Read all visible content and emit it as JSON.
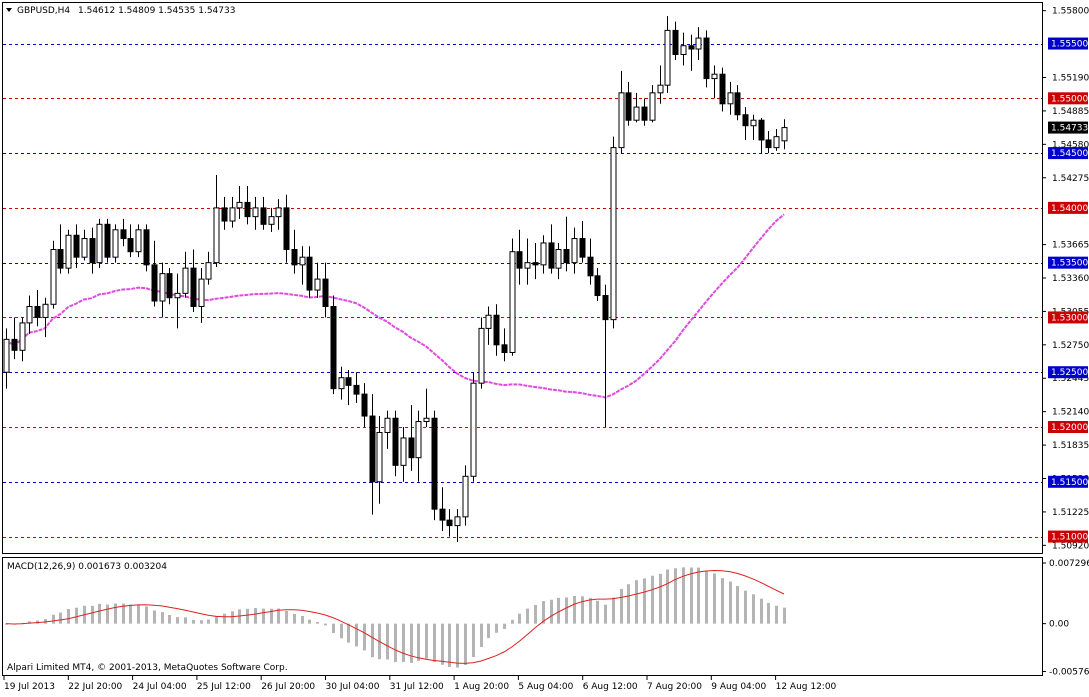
{
  "header": {
    "symbol": "GBPUSD,H4",
    "ohlc": "1.54612 1.54809 1.54535 1.54733"
  },
  "macd_header": {
    "label": "MACD(12,26,9) 0.001673 0.003204"
  },
  "footer": {
    "copyright": "Alpari Limited MT4, © 2001-2013, MetaQuotes Software Corp."
  },
  "colors": {
    "candle": "#000000",
    "bollinger": "#1e90ff",
    "ma_green": "#2ee08a",
    "ma_magenta": "#e04ae0",
    "level_blue": "#0000cc",
    "level_red": "#cc0000",
    "macd_hist": "#b4b4b4",
    "macd_signal": "#dd2222",
    "current_price_bg": "#000000"
  },
  "chart_data": [
    {
      "type": "candlestick",
      "name": "GBPUSD H4",
      "ylim": [
        1.5085,
        1.5587
      ],
      "y_ticks": [
        "1.55800",
        "1.55500",
        "1.55190",
        "1.54885",
        "1.54733",
        "1.54580",
        "1.54500",
        "1.54275",
        "1.54000",
        "1.53665",
        "1.53500",
        "1.53360",
        "1.53055",
        "1.53000",
        "1.52750",
        "1.52500",
        "1.52445",
        "1.52140",
        "1.52000",
        "1.51835",
        "1.51500",
        "1.51530",
        "1.51225",
        "1.51000",
        "1.50920"
      ],
      "price_labels": [
        {
          "text": "1.55800",
          "value": 1.558
        },
        {
          "text": "1.55190",
          "value": 1.5519
        },
        {
          "text": "1.54885",
          "value": 1.54885
        },
        {
          "text": "1.54580",
          "value": 1.5458
        },
        {
          "text": "1.54275",
          "value": 1.54275
        },
        {
          "text": "1.53665",
          "value": 1.53665
        },
        {
          "text": "1.53360",
          "value": 1.5336
        },
        {
          "text": "1.53055",
          "value": 1.53055
        },
        {
          "text": "1.52750",
          "value": 1.5275
        },
        {
          "text": "1.52445",
          "value": 1.52445
        },
        {
          "text": "1.52140",
          "value": 1.5214
        },
        {
          "text": "1.51835",
          "value": 1.51835
        },
        {
          "text": "1.51530",
          "value": 1.5153
        },
        {
          "text": "1.51225",
          "value": 1.51225
        },
        {
          "text": "1.50920",
          "value": 1.5092
        }
      ],
      "levels": [
        {
          "text": "1.55500",
          "value": 1.555,
          "color": "blue"
        },
        {
          "text": "1.55000",
          "value": 1.55,
          "color": "red"
        },
        {
          "text": "1.54500",
          "value": 1.545,
          "color": "blue"
        },
        {
          "text": "1.54000",
          "value": 1.54,
          "color": "red"
        },
        {
          "text": "1.53500",
          "value": 1.535,
          "color": "blue"
        },
        {
          "text": "1.53000",
          "value": 1.53,
          "color": "red"
        },
        {
          "text": "1.52500",
          "value": 1.525,
          "color": "blue"
        },
        {
          "text": "1.52000",
          "value": 1.52,
          "color": "red"
        },
        {
          "text": "1.51500",
          "value": 1.515,
          "color": "blue"
        },
        {
          "text": "1.51000",
          "value": 1.51,
          "color": "red"
        }
      ],
      "current_price": {
        "text": "1.54733",
        "value": 1.54733
      },
      "x_labels": [
        "19 Jul 2013",
        "22 Jul 20:00",
        "24 Jul 04:00",
        "25 Jul 12:00",
        "26 Jul 20:00",
        "30 Jul 04:00",
        "31 Jul 12:00",
        "1 Aug 20:00",
        "5 Aug 04:00",
        "6 Aug 12:00",
        "7 Aug 20:00",
        "9 Aug 04:00",
        "12 Aug 12:00"
      ],
      "ohlc": [
        [
          1.525,
          1.529,
          1.5235,
          1.528
        ],
        [
          1.528,
          1.53,
          1.5262,
          1.527
        ],
        [
          1.527,
          1.53,
          1.526,
          1.5295
        ],
        [
          1.5295,
          1.532,
          1.5285,
          1.531
        ],
        [
          1.531,
          1.5325,
          1.5292,
          1.53
        ],
        [
          1.53,
          1.5318,
          1.5282,
          1.5312
        ],
        [
          1.5312,
          1.537,
          1.5308,
          1.5362
        ],
        [
          1.5362,
          1.5385,
          1.534,
          1.5345
        ],
        [
          1.5345,
          1.538,
          1.534,
          1.5375
        ],
        [
          1.5375,
          1.5385,
          1.5345,
          1.5355
        ],
        [
          1.5355,
          1.538,
          1.5352,
          1.5372
        ],
        [
          1.5372,
          1.5382,
          1.534,
          1.535
        ],
        [
          1.535,
          1.539,
          1.5345,
          1.5385
        ],
        [
          1.5385,
          1.539,
          1.535,
          1.5355
        ],
        [
          1.5355,
          1.5385,
          1.535,
          1.538
        ],
        [
          1.538,
          1.539,
          1.5365,
          1.5372
        ],
        [
          1.5372,
          1.5385,
          1.5355,
          1.536
        ],
        [
          1.536,
          1.5385,
          1.5355,
          1.538
        ],
        [
          1.538,
          1.5385,
          1.5342,
          1.5348
        ],
        [
          1.5348,
          1.537,
          1.531,
          1.5315
        ],
        [
          1.5315,
          1.535,
          1.53,
          1.534
        ],
        [
          1.534,
          1.5345,
          1.5312,
          1.5318
        ],
        [
          1.5318,
          1.534,
          1.529,
          1.5322
        ],
        [
          1.5322,
          1.536,
          1.5318,
          1.5345
        ],
        [
          1.5345,
          1.5362,
          1.5305,
          1.531
        ],
        [
          1.531,
          1.5345,
          1.5295,
          1.5335
        ],
        [
          1.5335,
          1.536,
          1.533,
          1.535
        ],
        [
          1.535,
          1.543,
          1.5346,
          1.54
        ],
        [
          1.54,
          1.541,
          1.538,
          1.5388
        ],
        [
          1.5388,
          1.541,
          1.5382,
          1.54
        ],
        [
          1.54,
          1.542,
          1.539,
          1.5405
        ],
        [
          1.5405,
          1.542,
          1.5385,
          1.5392
        ],
        [
          1.5392,
          1.541,
          1.538,
          1.54
        ],
        [
          1.54,
          1.541,
          1.538,
          1.5385
        ],
        [
          1.5385,
          1.54,
          1.5378,
          1.5392
        ],
        [
          1.5392,
          1.5408,
          1.538,
          1.54
        ],
        [
          1.54,
          1.5412,
          1.535,
          1.5362
        ],
        [
          1.5362,
          1.538,
          1.534,
          1.5348
        ],
        [
          1.5348,
          1.5365,
          1.533,
          1.5355
        ],
        [
          1.5355,
          1.5365,
          1.5318,
          1.5325
        ],
        [
          1.5325,
          1.535,
          1.5318,
          1.5335
        ],
        [
          1.5335,
          1.535,
          1.53,
          1.531
        ],
        [
          1.531,
          1.532,
          1.523,
          1.5235
        ],
        [
          1.5235,
          1.5255,
          1.5225,
          1.5245
        ],
        [
          1.5245,
          1.5252,
          1.522,
          1.5238
        ],
        [
          1.5238,
          1.525,
          1.5222,
          1.523
        ],
        [
          1.523,
          1.524,
          1.52,
          1.521
        ],
        [
          1.521,
          1.523,
          1.512,
          1.515
        ],
        [
          1.515,
          1.521,
          1.513,
          1.5195
        ],
        [
          1.5195,
          1.5215,
          1.518,
          1.5208
        ],
        [
          1.5208,
          1.5215,
          1.5155,
          1.5165
        ],
        [
          1.5165,
          1.52,
          1.515,
          1.519
        ],
        [
          1.519,
          1.522,
          1.516,
          1.5172
        ],
        [
          1.5172,
          1.5215,
          1.515,
          1.5205
        ],
        [
          1.5205,
          1.5235,
          1.52,
          1.5208
        ],
        [
          1.5208,
          1.5215,
          1.5115,
          1.5125
        ],
        [
          1.5125,
          1.5145,
          1.5105,
          1.5115
        ],
        [
          1.5115,
          1.5125,
          1.51,
          1.511
        ],
        [
          1.511,
          1.5125,
          1.5095,
          1.5118
        ],
        [
          1.5118,
          1.5165,
          1.511,
          1.5155
        ],
        [
          1.5155,
          1.525,
          1.515,
          1.524
        ],
        [
          1.524,
          1.53,
          1.5235,
          1.529
        ],
        [
          1.529,
          1.531,
          1.5275,
          1.5302
        ],
        [
          1.5302,
          1.5312,
          1.5265,
          1.5275
        ],
        [
          1.5275,
          1.529,
          1.526,
          1.5268
        ],
        [
          1.5268,
          1.5372,
          1.5265,
          1.536
        ],
        [
          1.536,
          1.538,
          1.533,
          1.5345
        ],
        [
          1.5345,
          1.5372,
          1.533,
          1.535
        ],
        [
          1.535,
          1.5368,
          1.5335,
          1.5348
        ],
        [
          1.5348,
          1.5375,
          1.534,
          1.5368
        ],
        [
          1.5368,
          1.5385,
          1.534,
          1.5345
        ],
        [
          1.5345,
          1.5368,
          1.5335,
          1.5362
        ],
        [
          1.5362,
          1.5392,
          1.5342,
          1.535
        ],
        [
          1.535,
          1.5382,
          1.534,
          1.5372
        ],
        [
          1.5372,
          1.5388,
          1.535,
          1.5355
        ],
        [
          1.5355,
          1.5372,
          1.533,
          1.5338
        ],
        [
          1.5338,
          1.5345,
          1.5315,
          1.532
        ],
        [
          1.532,
          1.533,
          1.52,
          1.5298
        ],
        [
          1.5298,
          1.5465,
          1.529,
          1.5455
        ],
        [
          1.5455,
          1.5525,
          1.545,
          1.5505
        ],
        [
          1.5505,
          1.5515,
          1.5475,
          1.548
        ],
        [
          1.548,
          1.5505,
          1.5478,
          1.5492
        ],
        [
          1.5492,
          1.55,
          1.5475,
          1.548
        ],
        [
          1.548,
          1.5512,
          1.5478,
          1.5505
        ],
        [
          1.5505,
          1.553,
          1.5495,
          1.5512
        ],
        [
          1.5512,
          1.5575,
          1.5505,
          1.5562
        ],
        [
          1.5562,
          1.557,
          1.5535,
          1.554
        ],
        [
          1.554,
          1.556,
          1.553,
          1.5548
        ],
        [
          1.5548,
          1.5558,
          1.5525,
          1.5545
        ],
        [
          1.5545,
          1.5565,
          1.5535,
          1.5555
        ],
        [
          1.5555,
          1.5562,
          1.551,
          1.5518
        ],
        [
          1.5518,
          1.553,
          1.55,
          1.5522
        ],
        [
          1.5522,
          1.5528,
          1.5488,
          1.5495
        ],
        [
          1.5495,
          1.5515,
          1.5485,
          1.5505
        ],
        [
          1.5505,
          1.5512,
          1.548,
          1.5485
        ],
        [
          1.5485,
          1.5492,
          1.5462,
          1.5475
        ],
        [
          1.5475,
          1.5485,
          1.5462,
          1.548
        ],
        [
          1.548,
          1.5482,
          1.545,
          1.5462
        ],
        [
          1.5462,
          1.547,
          1.545,
          1.5455
        ],
        [
          1.5455,
          1.5472,
          1.5452,
          1.5465
        ],
        [
          1.54612,
          1.54809,
          1.54535,
          1.54733
        ]
      ]
    },
    {
      "type": "bar",
      "name": "MACD(12,26,9)",
      "ylim": [
        -0.0063,
        0.0079
      ],
      "y_ticks": [
        "0.007296",
        "0.00",
        "-0.005762"
      ],
      "y_tick_values": [
        0.007296,
        0.0,
        -0.005762
      ]
    }
  ]
}
